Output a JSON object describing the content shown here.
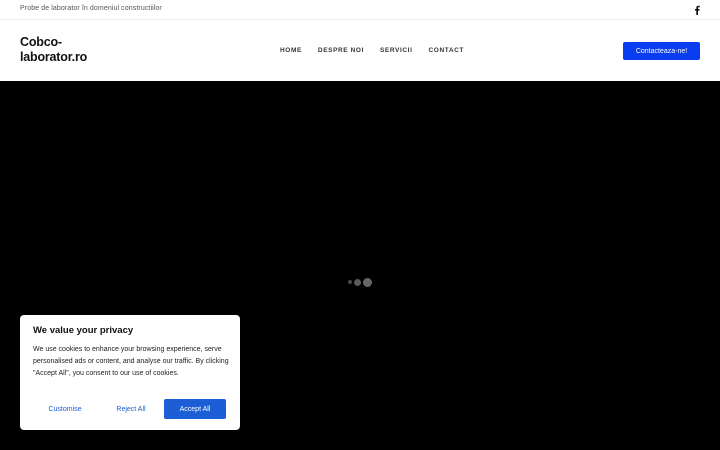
{
  "topbar": {
    "tagline": "Probe de laborator în domeniul constructiilor",
    "social_icon": "facebook-icon"
  },
  "header": {
    "logo_line1": "Cobco-",
    "logo_line2": "laborator.ro",
    "nav": [
      {
        "label": "HOME"
      },
      {
        "label": "DESPRE NOI"
      },
      {
        "label": "SERVICII"
      },
      {
        "label": "CONTACT"
      }
    ],
    "cta_label": "Contacteaza-ne!"
  },
  "hero": {
    "loader_icon": "loading-dots-icon"
  },
  "cookie_banner": {
    "title": "We value your privacy",
    "body": "We use cookies to enhance your browsing experience, serve personalised ads or content, and analyse our traffic. By clicking \"Accept All\", you consent to our use of cookies.",
    "customise_label": "Customise",
    "reject_label": "Reject All",
    "accept_label": "Accept All"
  },
  "colors": {
    "accent": "#0a3cf0",
    "cookie_accent": "#1c5ed6",
    "hero_bg": "#000000"
  }
}
